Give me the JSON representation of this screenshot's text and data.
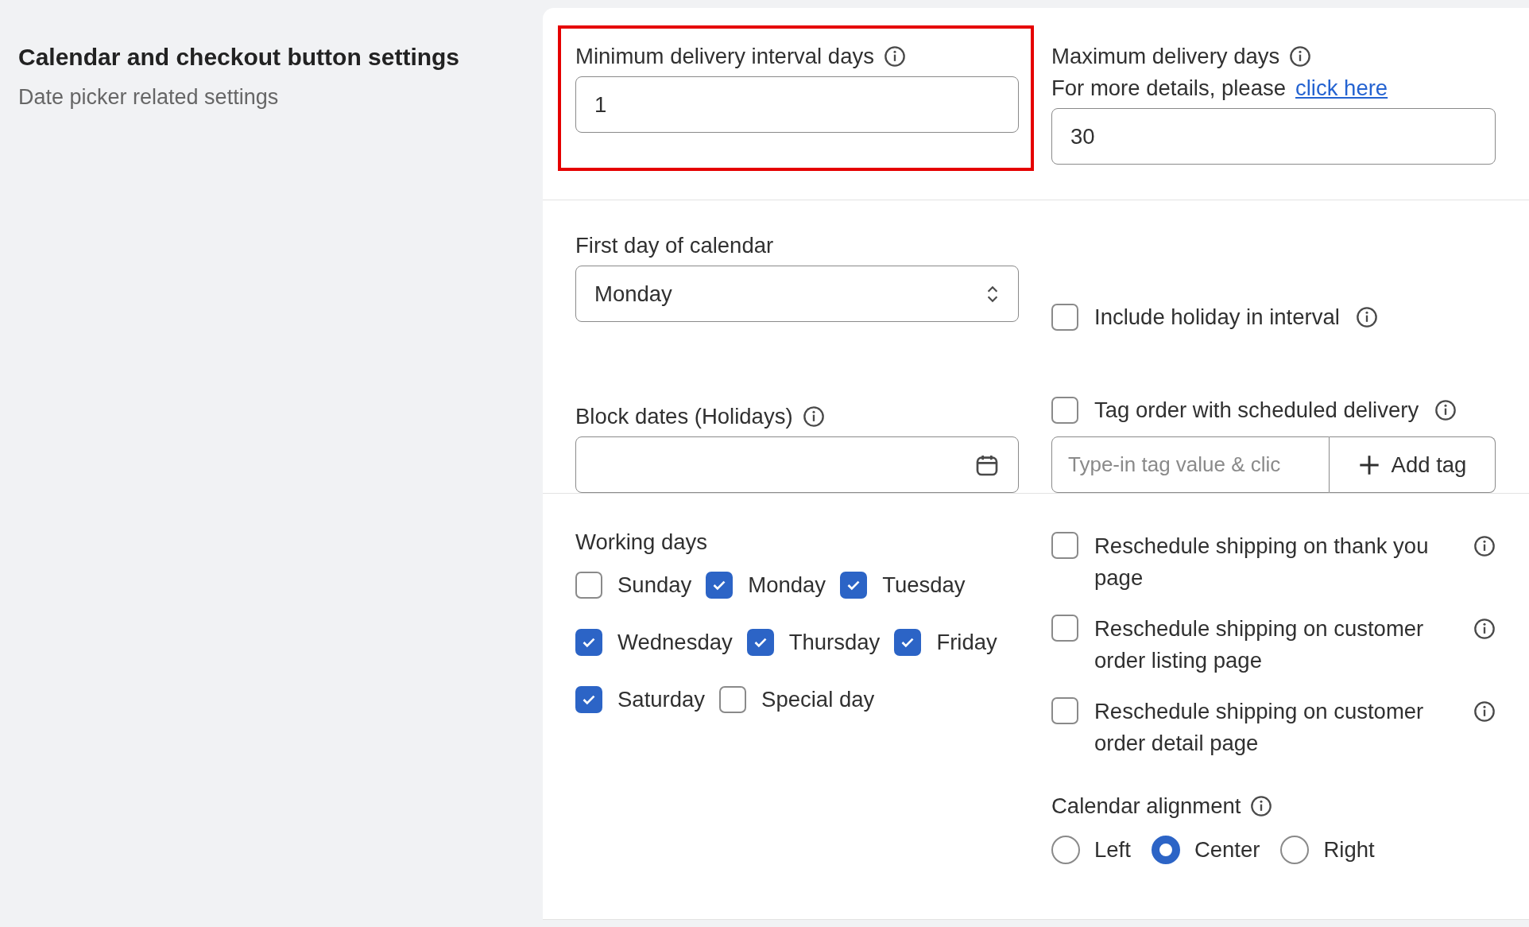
{
  "sidebar": {
    "title": "Calendar and checkout button settings",
    "subtitle": "Date picker related settings"
  },
  "min_interval": {
    "label": "Minimum delivery interval days",
    "value": "1",
    "highlighted": true
  },
  "max_days": {
    "label": "Maximum delivery days",
    "hint": "For more details, please",
    "link": "click here",
    "value": "30"
  },
  "first_day": {
    "label": "First day of calendar",
    "value": "Monday"
  },
  "include_holiday": {
    "label": "Include holiday in interval",
    "checked": false
  },
  "block_dates": {
    "label": "Block dates (Holidays)"
  },
  "tag_order": {
    "label": "Tag order with scheduled delivery",
    "checked": false,
    "placeholder": "Type-in tag value & clic",
    "button": "Add tag"
  },
  "working_days": {
    "label": "Working days",
    "rows": [
      [
        {
          "label": "Sunday",
          "checked": false
        },
        {
          "label": "Monday",
          "checked": true
        },
        {
          "label": "Tuesday",
          "checked": true
        }
      ],
      [
        {
          "label": "Wednesday",
          "checked": true
        },
        {
          "label": "Thursday",
          "checked": true
        },
        {
          "label": "Friday",
          "checked": true
        }
      ],
      [
        {
          "label": "Saturday",
          "checked": true
        },
        {
          "label": "Special day",
          "checked": false
        }
      ]
    ]
  },
  "reschedule": [
    {
      "label": "Reschedule shipping on thank you page",
      "checked": false
    },
    {
      "label": "Reschedule shipping on customer order listing page",
      "checked": false
    },
    {
      "label": "Reschedule shipping on customer order detail page",
      "checked": false
    }
  ],
  "alignment": {
    "label": "Calendar alignment",
    "options": [
      {
        "label": "Left",
        "selected": false
      },
      {
        "label": "Center",
        "selected": true
      },
      {
        "label": "Right",
        "selected": false
      }
    ]
  }
}
